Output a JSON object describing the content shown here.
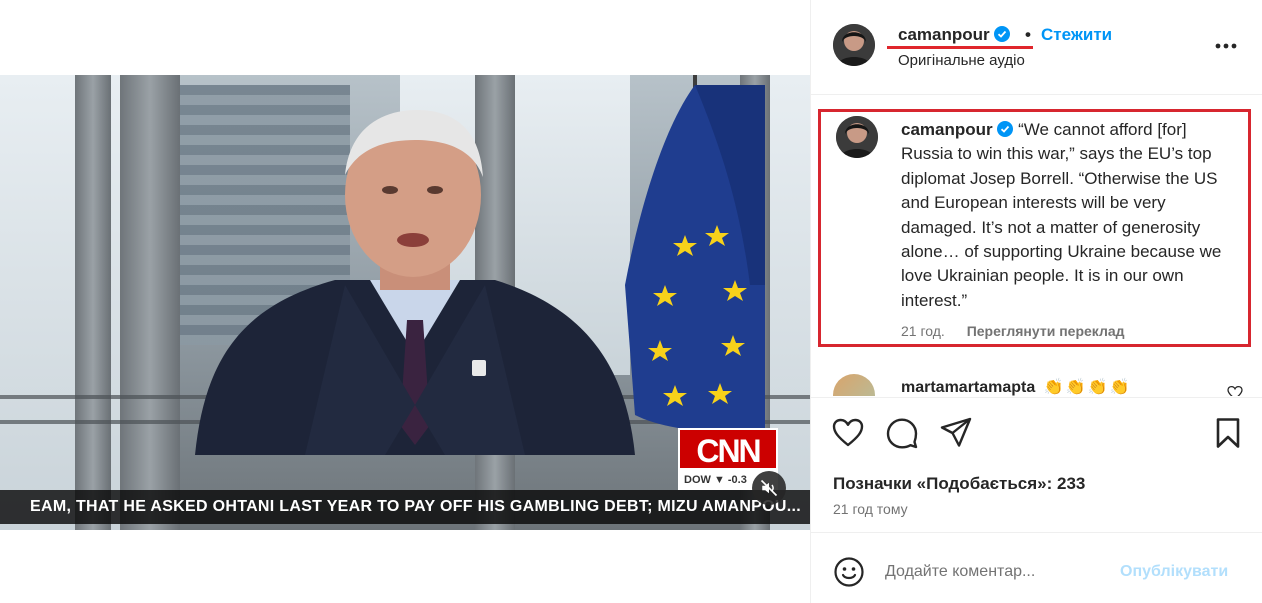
{
  "video": {
    "lower_third": "EAM, THAT HE ASKED OHTANI LAST YEAR TO PAY OFF HIS GAMBLING DEBT; MIZU AMANPOU...",
    "network_logo": "CNN",
    "market_ticker": "DOW ▼ -0.3",
    "mute_icon": "speaker-muted-icon"
  },
  "header": {
    "username": "camanpour",
    "separator": "•",
    "follow_label": "Стежити",
    "audio_label": "Оригінальне аудіо",
    "more_icon": "more-horizontal-icon"
  },
  "caption": {
    "username": "camanpour",
    "text": "“We cannot afford [for] Russia to win this war,” says the EU’s top diplomat Josep Borrell. “Otherwise the US and European interests will be very damaged. It’s not a matter of generosity alone… of supporting Ukraine because we love Ukrainian people. It is in our own interest.”",
    "time": "21 год.",
    "translate_label": "Переглянути переклад"
  },
  "comment": {
    "username": "martamartamapta",
    "emoji": "👏👏👏👏"
  },
  "actions": {
    "likes": "Позначки «Подобається»: 233",
    "time_ago": "21 год тому"
  },
  "add_comment": {
    "placeholder": "Додайте коментар...",
    "publish_label": "Опублікувати"
  },
  "colors": {
    "accent": "#0095f6",
    "highlight": "#d7262f",
    "publish_disabled": "#b2dffc"
  }
}
